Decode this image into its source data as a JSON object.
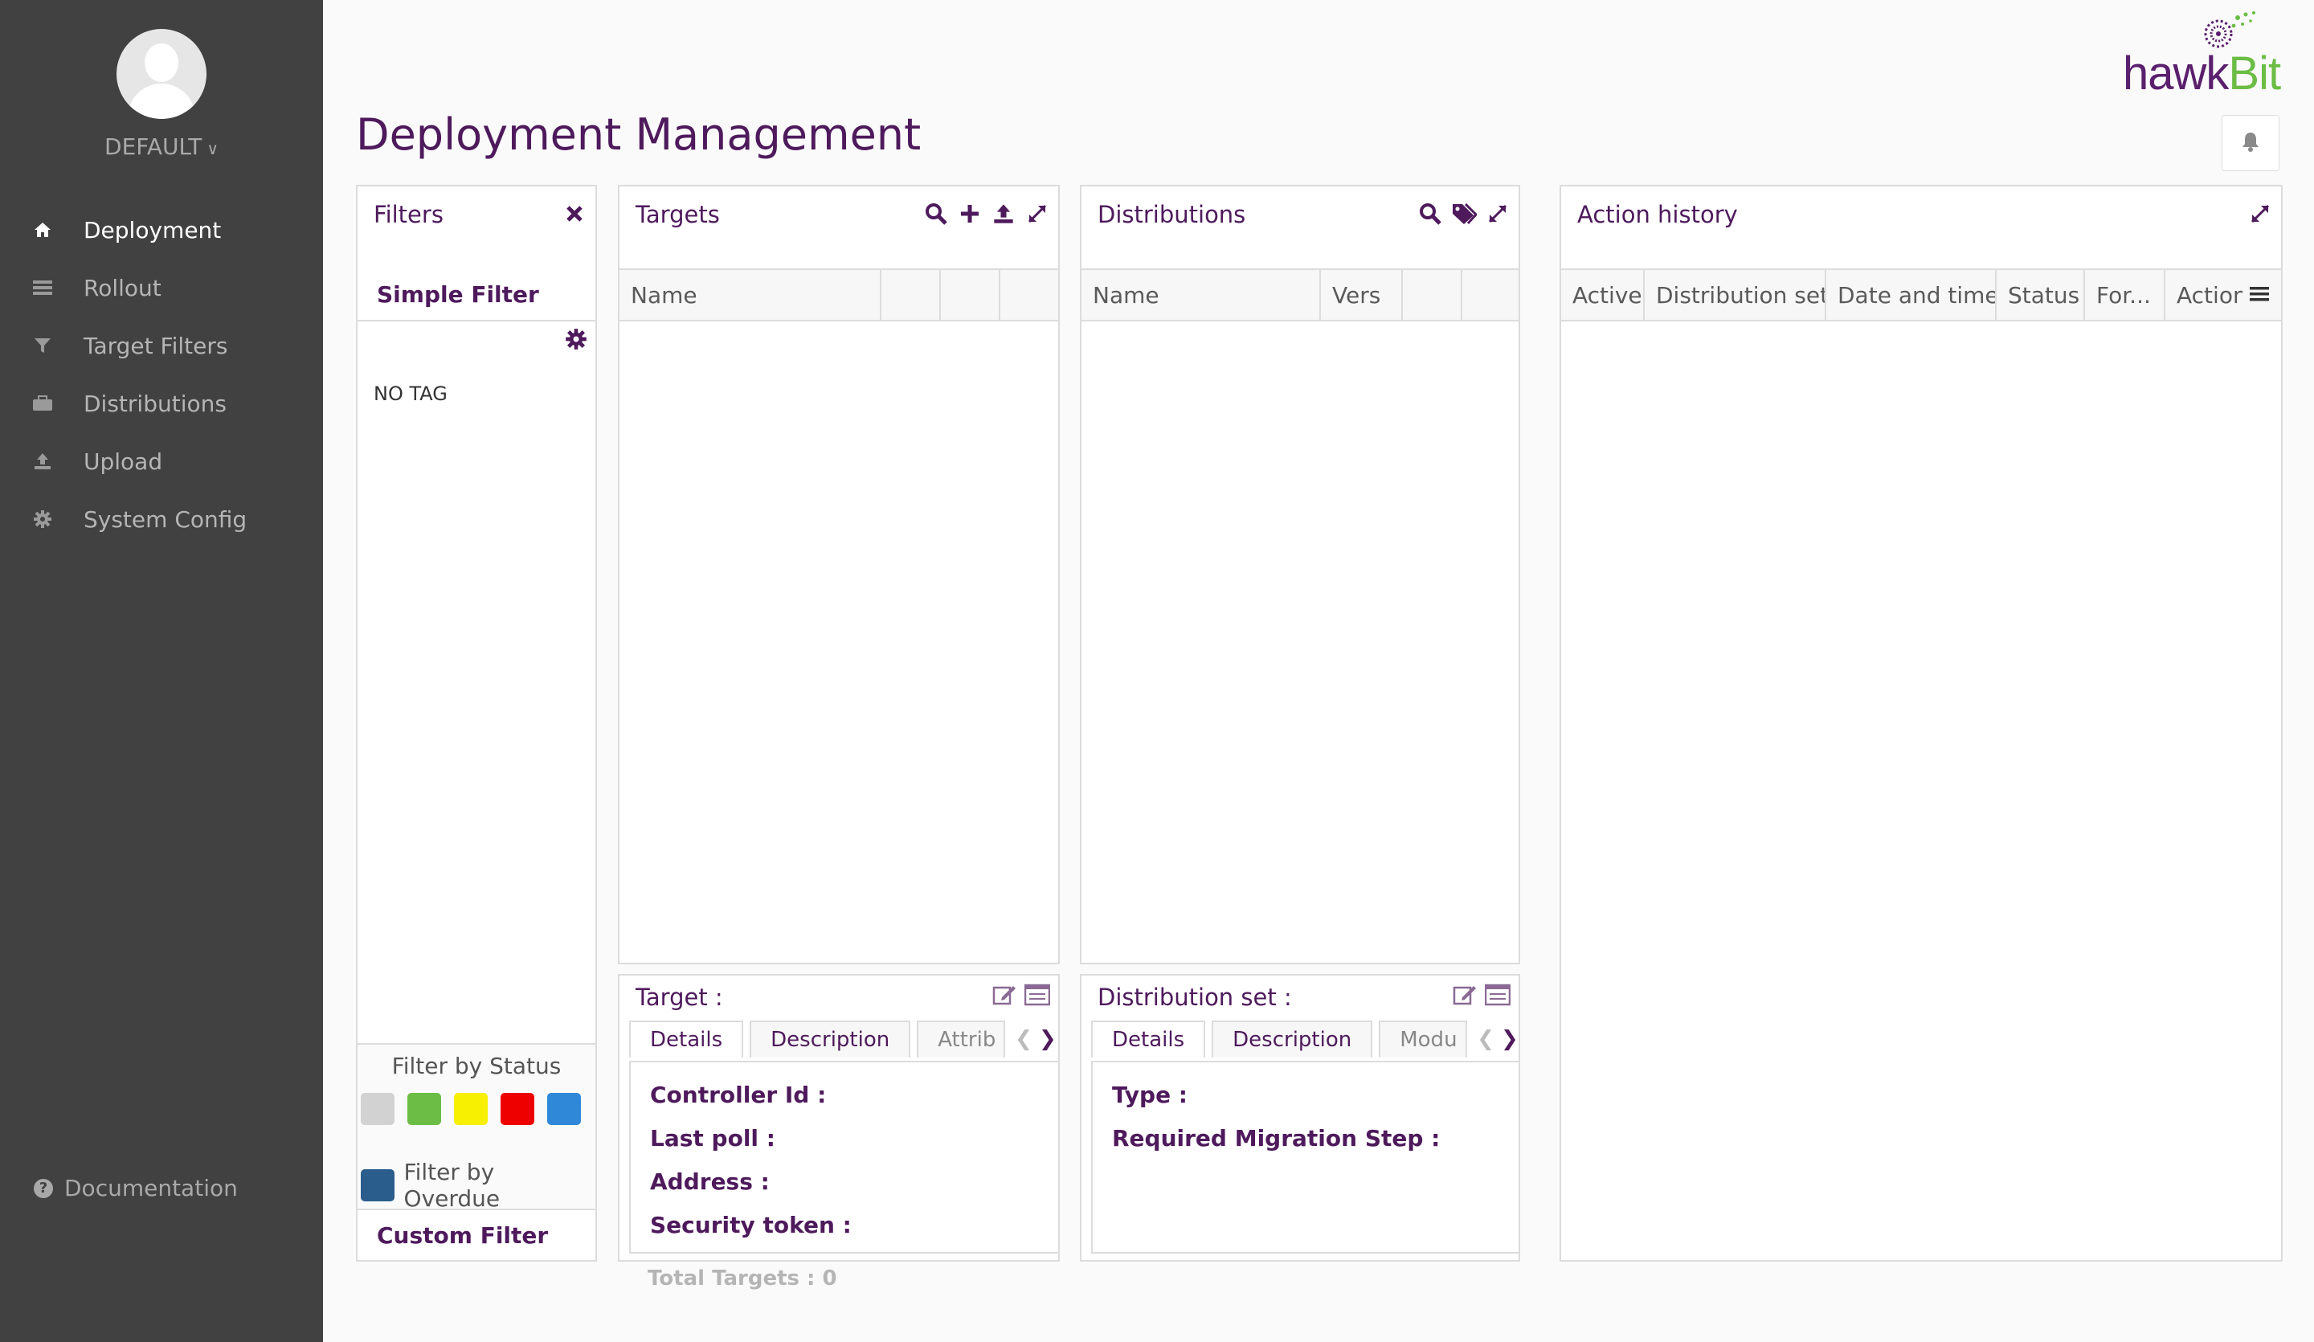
{
  "sidebar": {
    "user": "DEFAULT",
    "items": [
      {
        "label": "Deployment",
        "icon": "home-icon"
      },
      {
        "label": "Rollout",
        "icon": "list-icon"
      },
      {
        "label": "Target Filters",
        "icon": "filter-icon"
      },
      {
        "label": "Distributions",
        "icon": "briefcase-icon"
      },
      {
        "label": "Upload",
        "icon": "upload-icon"
      },
      {
        "label": "System Config",
        "icon": "gear-icon"
      }
    ],
    "documentation": "Documentation"
  },
  "header": {
    "title": "Deployment Management",
    "logo_hawk": "hawk",
    "logo_bit": "Bit"
  },
  "filters": {
    "title": "Filters",
    "simple_filter": "Simple Filter",
    "no_tag": "NO TAG",
    "status_title": "Filter by Status",
    "status_colors": [
      "#d2d2d2",
      "#6cbd45",
      "#f7f000",
      "#ee0000",
      "#2f88d8"
    ],
    "overdue_label": "Filter by Overdue",
    "overdue_color": "#2a5d8c",
    "custom_filter": "Custom Filter"
  },
  "targets": {
    "title": "Targets",
    "columns": [
      "Name",
      "",
      "",
      ""
    ]
  },
  "distributions": {
    "title": "Distributions",
    "columns": [
      "Name",
      "Vers",
      "",
      ""
    ]
  },
  "action_history": {
    "title": "Action history",
    "columns": [
      "Active",
      "Distribution set",
      "Date and time",
      "Status",
      "For...",
      "Actions"
    ]
  },
  "target_details": {
    "title": "Target :",
    "tabs": [
      "Details",
      "Description",
      "Attrib"
    ],
    "fields": [
      "Controller Id :",
      "Last poll :",
      "Address :",
      "Security token :"
    ]
  },
  "distribution_details": {
    "title": "Distribution set :",
    "tabs": [
      "Details",
      "Description",
      "Modu"
    ],
    "fields": [
      "Type :",
      "Required Migration Step :"
    ]
  },
  "footer": {
    "total_targets": "Total Targets : 0"
  },
  "colors": {
    "brand_purple": "#4e1a5c",
    "sidebar_bg": "#414141",
    "logo_green": "#6bbd45"
  }
}
